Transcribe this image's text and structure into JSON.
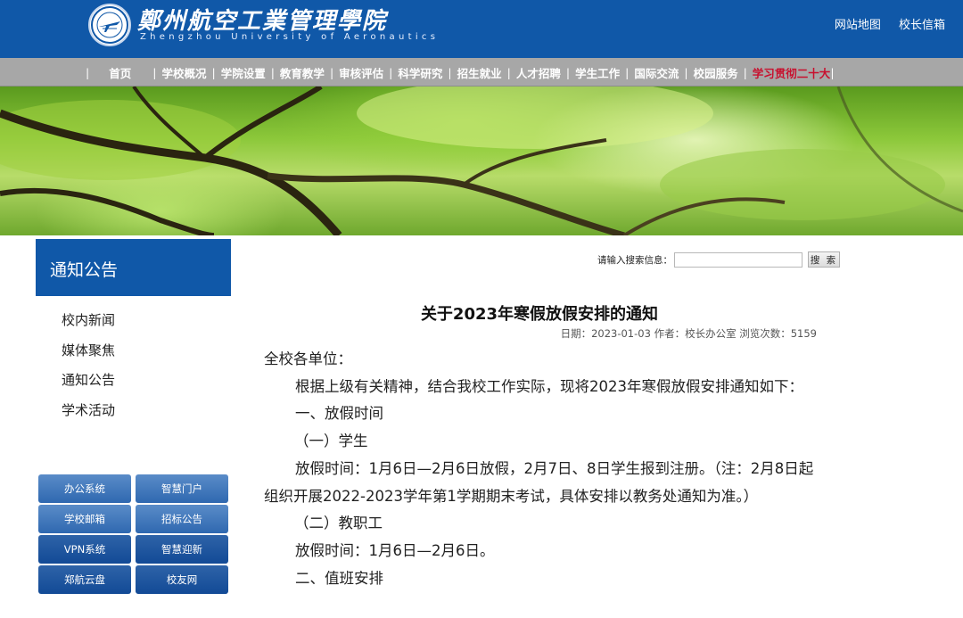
{
  "header": {
    "logo_cn": "鄭州航空工業管理學院",
    "logo_en": "Zhengzhou University of Aeronautics",
    "links": [
      "网站地图",
      "校长信箱"
    ],
    "colors": {
      "header_bg": "#1058a8",
      "nav_bg": "#a7a7a7",
      "nav_highlight": "#c8102e"
    }
  },
  "nav": {
    "home": "首页",
    "items": [
      "学校概况",
      "学院设置",
      "教育教学",
      "审核评估",
      "科学研究",
      "招生就业",
      "人才招聘",
      "学生工作",
      "国际交流",
      "校园服务"
    ],
    "highlight": "学习贯彻二十大"
  },
  "sidebar": {
    "title": "通知公告",
    "items": [
      "校内新闻",
      "媒体聚焦",
      "通知公告",
      "学术活动"
    ],
    "quick_links": [
      "办公系统",
      "智慧门户",
      "学校邮箱",
      "招标公告",
      "VPN系统",
      "智慧迎新",
      "郑航云盘",
      "校友网"
    ]
  },
  "search": {
    "label": "请输入搜索信息：",
    "value": "",
    "button": "搜 索"
  },
  "article": {
    "title": "关于2023年寒假放假安排的通知",
    "meta": "日期：2023-01-03 作者：校长办公室 浏览次数：5159",
    "paragraphs": [
      "全校各单位：",
      "根据上级有关精神，结合我校工作实际，现将2023年寒假放假安排通知如下：",
      "一、放假时间",
      "（一）学生",
      "放假时间：1月6日—2月6日放假，2月7日、8日学生报到注册。（注：2月8日起组织开展2022-2023学年第1学期期末考试，具体安排以教务处通知为准。）",
      "（二）教职工",
      "放假时间：1月6日—2月6日。",
      "二、值班安排"
    ]
  }
}
